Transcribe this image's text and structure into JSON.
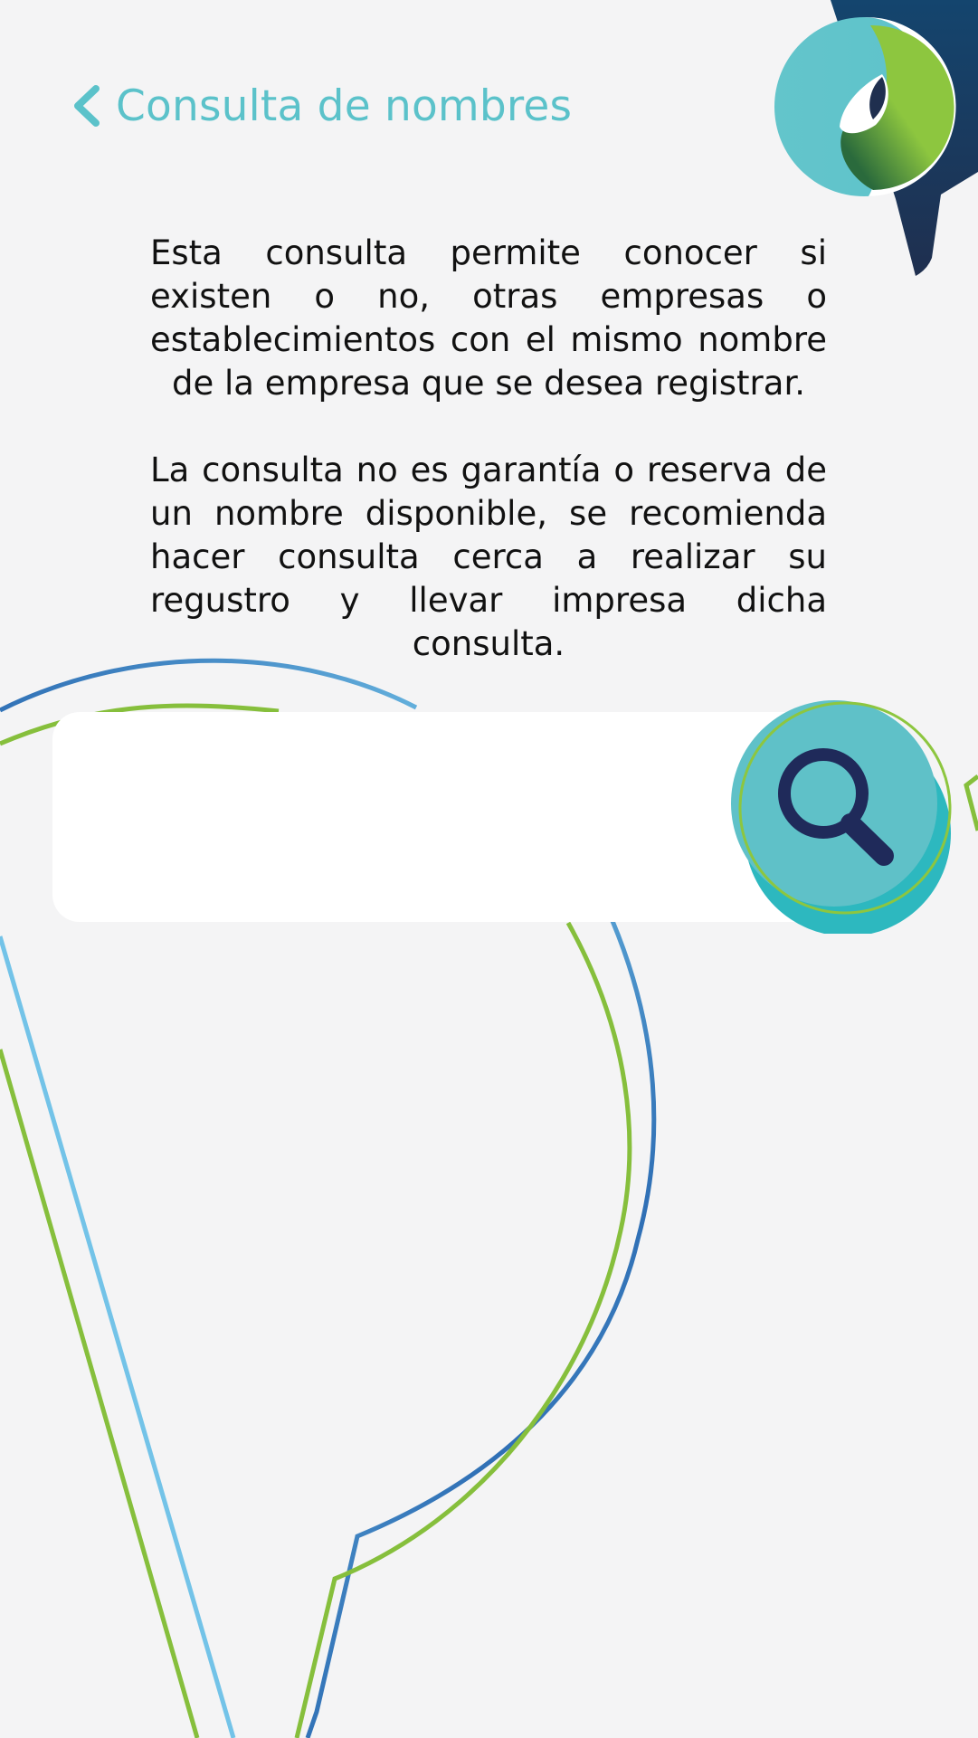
{
  "header": {
    "title": "Consulta de nombres",
    "back_icon": "chevron-left-icon"
  },
  "description": {
    "paragraph_1": "Esta consulta permite conocer si existen o no, otras empresas o establecimientos con el mismo nombre de la empresa que se desea registrar.",
    "paragraph_2": "La consulta no es garantía o reserva de un nombre disponible, se recomienda hacer consulta cerca a realizar su regustro y llevar impresa dicha consulta."
  },
  "search": {
    "value": "",
    "placeholder": "",
    "button_icon": "search-icon"
  },
  "colors": {
    "accent": "#5bc2ca",
    "line_green": "#7fbf3a",
    "line_blue": "#69bde6",
    "navy": "#1f2a5a",
    "background": "#f4f4f5"
  }
}
